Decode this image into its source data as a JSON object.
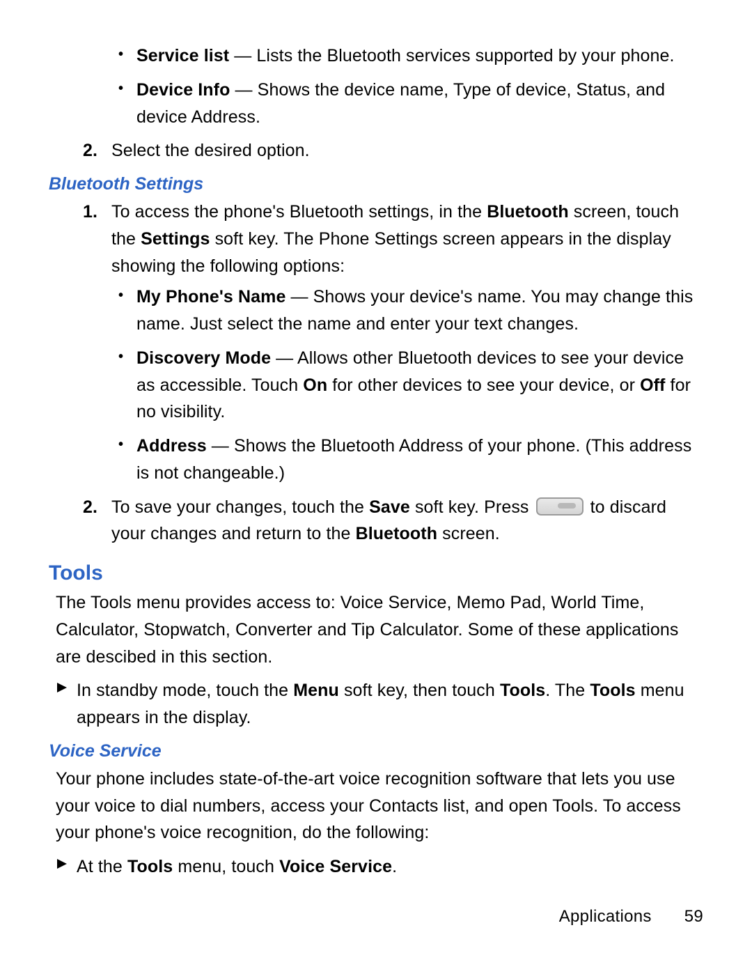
{
  "top_sub_bullets": {
    "service_list": {
      "label": "Service list",
      "desc": " — Lists the Bluetooth services supported by your phone."
    },
    "device_info": {
      "label": "Device Info",
      "desc": " — Shows the device name, Type of device, Status, and device Address."
    }
  },
  "ol_top_2": {
    "num": "2.",
    "text": "Select the desired option."
  },
  "bluetooth_settings": {
    "heading": "Bluetooth Settings",
    "step1": {
      "num": "1.",
      "pre": "To access the phone's Bluetooth settings, in the ",
      "bold1": "Bluetooth",
      "mid": " screen, touch the ",
      "bold2": "Settings",
      "post": " soft key. The Phone Settings screen appears in the display showing the following options:"
    },
    "bullets": {
      "phone_name": {
        "label": "My Phone's Name",
        "desc": " — Shows your device's name. You may change this name. Just select the name and enter your text changes."
      },
      "discovery": {
        "label": "Discovery Mode",
        "desc1": " — Allows other Bluetooth devices to see your device as accessible. Touch ",
        "on": "On",
        "desc2": " for other devices to see your device, or ",
        "off": "Off",
        "desc3": " for no visibility."
      },
      "address": {
        "label": "Address",
        "desc": " — Shows the Bluetooth Address of your phone. (This address is not changeable.)"
      }
    },
    "step2": {
      "num": "2.",
      "pre": "To save your changes, touch the ",
      "save": "Save",
      "mid": " soft key. Press ",
      "post1": " to discard your changes and return to the ",
      "bluetooth": "Bluetooth",
      "post2": " screen."
    }
  },
  "tools": {
    "heading": "Tools",
    "intro": "The Tools menu provides access to: Voice Service, Memo Pad, World Time, Calculator, Stopwatch, Converter and Tip Calculator. Some of these applications are descibed in this section.",
    "arrow": {
      "pre": "In standby mode, touch the ",
      "menu": "Menu",
      "mid": " soft key, then touch ",
      "tools1": "Tools",
      "mid2": ". The ",
      "tools2": "Tools",
      "post": " menu appears in the display."
    }
  },
  "voice_service": {
    "heading": "Voice Service",
    "intro": "Your phone includes state-of-the-art voice recognition software that lets you use your voice to dial numbers, access your Contacts list, and open Tools. To access your phone's voice recognition, do the following:",
    "arrow": {
      "pre": "At the ",
      "tools": "Tools",
      "mid": " menu, touch ",
      "vs": "Voice Service",
      "post": "."
    }
  },
  "footer": {
    "section": "Applications",
    "page": "59"
  }
}
